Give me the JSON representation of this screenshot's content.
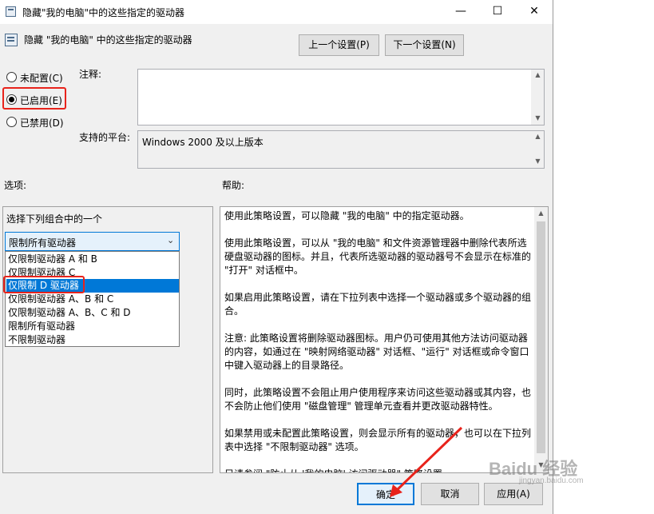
{
  "window": {
    "title": "隐藏\"我的电脑\"中的这些指定的驱动器",
    "minimize_glyph": "—",
    "maximize_glyph": "☐",
    "close_glyph": "✕"
  },
  "header": {
    "policy_name": "隐藏 \"我的电脑\" 中的这些指定的驱动器",
    "prev_button": "上一个设置(P)",
    "next_button": "下一个设置(N)"
  },
  "state": {
    "options": [
      {
        "label": "未配置(C)",
        "selected": false
      },
      {
        "label": "已启用(E)",
        "selected": true
      },
      {
        "label": "已禁用(D)",
        "selected": false
      }
    ]
  },
  "comment": {
    "label": "注释:",
    "value": ""
  },
  "platform": {
    "label": "支持的平台:",
    "value": "Windows 2000 及以上版本"
  },
  "options_section": {
    "label": "选项:",
    "combo_label": "选择下列组合中的一个",
    "selected_value": "限制所有驱动器",
    "dropdown_items": [
      {
        "label": "仅限制驱动器 A 和 B",
        "highlighted": false
      },
      {
        "label": "仅限制驱动器 C",
        "highlighted": false
      },
      {
        "label": "仅限制 D 驱动器",
        "highlighted": true
      },
      {
        "label": "仅限制驱动器 A、B 和 C",
        "highlighted": false
      },
      {
        "label": "仅限制驱动器 A、B、C 和 D",
        "highlighted": false
      },
      {
        "label": "限制所有驱动器",
        "highlighted": false
      },
      {
        "label": "不限制驱动器",
        "highlighted": false
      }
    ]
  },
  "help_section": {
    "label": "帮助:",
    "paragraphs": [
      "使用此策略设置，可以隐藏 \"我的电脑\" 中的指定驱动器。",
      "使用此策略设置，可以从 \"我的电脑\" 和文件资源管理器中删除代表所选硬盘驱动器的图标。并且，代表所选驱动器的驱动器号不会显示在标准的 \"打开\" 对话框中。",
      "如果启用此策略设置，请在下拉列表中选择一个驱动器或多个驱动器的组合。",
      "注意: 此策略设置将删除驱动器图标。用户仍可使用其他方法访问驱动器的内容，如通过在 \"映射网络驱动器\" 对话框、\"运行\" 对话框或命令窗口中键入驱动器上的目录路径。",
      "同时，此策略设置不会阻止用户使用程序来访问这些驱动器或其内容，也不会防止他们使用 \"磁盘管理\" 管理单元查看并更改驱动器特性。",
      "如果禁用或未配置此策略设置，则会显示所有的驱动器，也可以在下拉列表中选择 \"不限制驱动器\" 选项。",
      "另请参阅 \"防止从 '我的电脑' 访问驱动器\" 策略设置。"
    ]
  },
  "footer": {
    "ok": "确定",
    "cancel": "取消",
    "apply": "应用(A)"
  },
  "watermark": {
    "text": "Baidu 经验",
    "subtext": "jingyan.baidu.com"
  },
  "colors": {
    "highlight": "#0078d7",
    "annotation": "#e8231b"
  }
}
